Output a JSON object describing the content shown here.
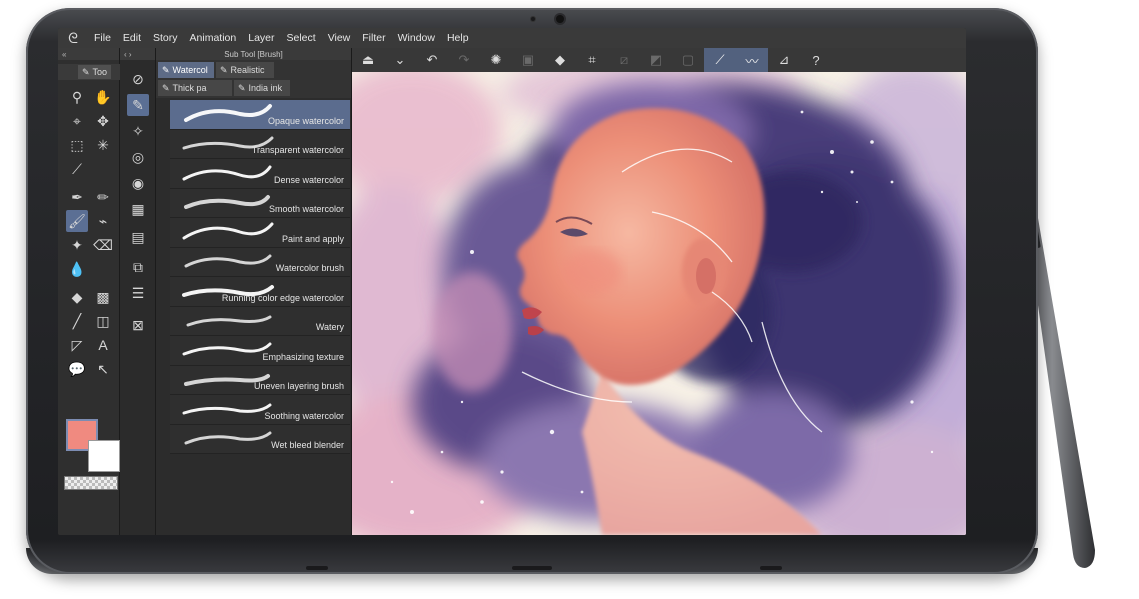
{
  "menu": [
    "File",
    "Edit",
    "Story",
    "Animation",
    "Layer",
    "Select",
    "View",
    "Filter",
    "Window",
    "Help"
  ],
  "tool_panel": {
    "tab_label": "Too"
  },
  "sub_tool": {
    "title": "Sub Tool [Brush]",
    "tabs": [
      "Watercol",
      "Realistic",
      "Thick pa",
      "India ink"
    ],
    "selected_tab": "Watercol",
    "brushes": [
      "Opaque watercolor",
      "Transparent watercolor",
      "Dense watercolor",
      "Smooth watercolor",
      "Paint and apply",
      "Watercolor brush",
      "Running color edge watercolor",
      "Watery",
      "Emphasizing texture",
      "Uneven layering brush",
      "Soothing watercolor",
      "Wet bleed blender"
    ],
    "selected_brush": "Opaque watercolor"
  },
  "colors": {
    "main": "#f08a80",
    "sub": "#ffffff",
    "accent": "#5b6c8e"
  }
}
